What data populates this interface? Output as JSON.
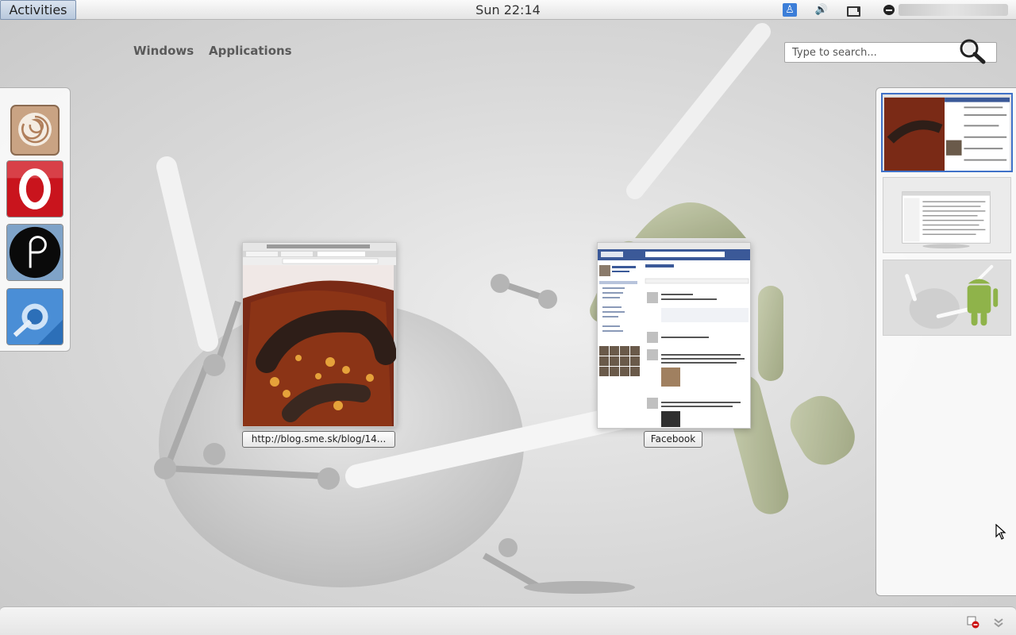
{
  "top_panel": {
    "activities_label": "Activities",
    "clock": "Sun 22:14",
    "tray_icons": [
      "accessibility-icon",
      "volume-icon",
      "battery-icon",
      "chat-status-icon"
    ]
  },
  "overview": {
    "tabs": [
      {
        "label": "Windows"
      },
      {
        "label": "Applications"
      }
    ],
    "search": {
      "placeholder": "Type to search..."
    }
  },
  "dash": {
    "items": [
      {
        "name": "Files",
        "icon": "nautilus-icon"
      },
      {
        "name": "Opera",
        "icon": "opera-icon"
      },
      {
        "name": "Pidgin",
        "icon": "pidgin-icon"
      },
      {
        "name": "Chromium",
        "icon": "chromium-icon"
      }
    ]
  },
  "windows": [
    {
      "label": "http://blog.sme.sk/blog/14...",
      "kind": "photo-browser"
    },
    {
      "label": "Facebook",
      "kind": "facebook-browser"
    }
  ],
  "workspaces": {
    "count": 3,
    "active": 1
  },
  "colors": {
    "activities_bg": "#c5d3e5",
    "workspace_highlight": "#3f71c8",
    "opera_red": "#c9141d",
    "facebook_blue": "#3b5998"
  }
}
